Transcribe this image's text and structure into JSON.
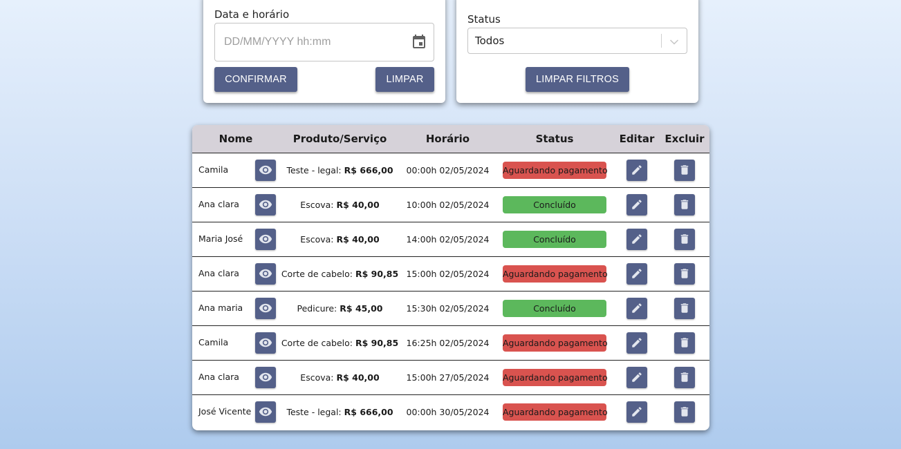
{
  "date_card": {
    "label": "Data e horário",
    "placeholder": "DD/MM/YYYY hh:mm",
    "confirm_label": "CONFIRMAR",
    "clear_label": "LIMPAR"
  },
  "filter_card": {
    "status_label": "Status",
    "status_value": "Todos",
    "clear_filters_label": "LIMPAR FILTROS"
  },
  "table": {
    "headers": {
      "name": "Nome",
      "product": "Produto/Serviço",
      "time": "Horário",
      "status": "Status",
      "edit": "Editar",
      "delete": "Excluir"
    },
    "rows": [
      {
        "name": "Camila",
        "service": "Teste - legal:",
        "price": "R$ 666,00",
        "time": "00:00h 02/05/2024",
        "status": "Aguardando pagamento",
        "status_color": "#d9534f"
      },
      {
        "name": "Ana clara",
        "service": "Escova:",
        "price": "R$ 40,00",
        "time": "10:00h 02/05/2024",
        "status": "Concluído",
        "status_color": "#5cb85c"
      },
      {
        "name": "Maria José",
        "service": "Escova:",
        "price": "R$ 40,00",
        "time": "14:00h 02/05/2024",
        "status": "Concluído",
        "status_color": "#5cb85c"
      },
      {
        "name": "Ana clara",
        "service": "Corte de cabelo:",
        "price": "R$ 90,85",
        "time": "15:00h 02/05/2024",
        "status": "Aguardando pagamento",
        "status_color": "#d9534f"
      },
      {
        "name": "Ana maria",
        "service": "Pedicure:",
        "price": "R$ 45,00",
        "time": "15:30h 02/05/2024",
        "status": "Concluído",
        "status_color": "#5cb85c"
      },
      {
        "name": "Camila",
        "service": "Corte de cabelo:",
        "price": "R$ 90,85",
        "time": "16:25h 02/05/2024",
        "status": "Aguardando pagamento",
        "status_color": "#d9534f"
      },
      {
        "name": "Ana clara",
        "service": "Escova:",
        "price": "R$ 40,00",
        "time": "15:00h 27/05/2024",
        "status": "Aguardando pagamento",
        "status_color": "#d9534f"
      },
      {
        "name": "José Vicente",
        "service": "Teste - legal:",
        "price": "R$ 666,00",
        "time": "00:00h 30/05/2024",
        "status": "Aguardando pagamento",
        "status_color": "#d9534f"
      }
    ]
  },
  "icons": {
    "calendar": "calendar-icon",
    "chevron": "chevron-down-icon",
    "view": "eye-icon",
    "edit": "pencil-icon",
    "delete": "trash-icon"
  },
  "colors": {
    "primary_button": "#546089",
    "status_pending": "#d9534f",
    "status_done": "#5cb85c",
    "table_header_bg": "#d6d2d9"
  }
}
